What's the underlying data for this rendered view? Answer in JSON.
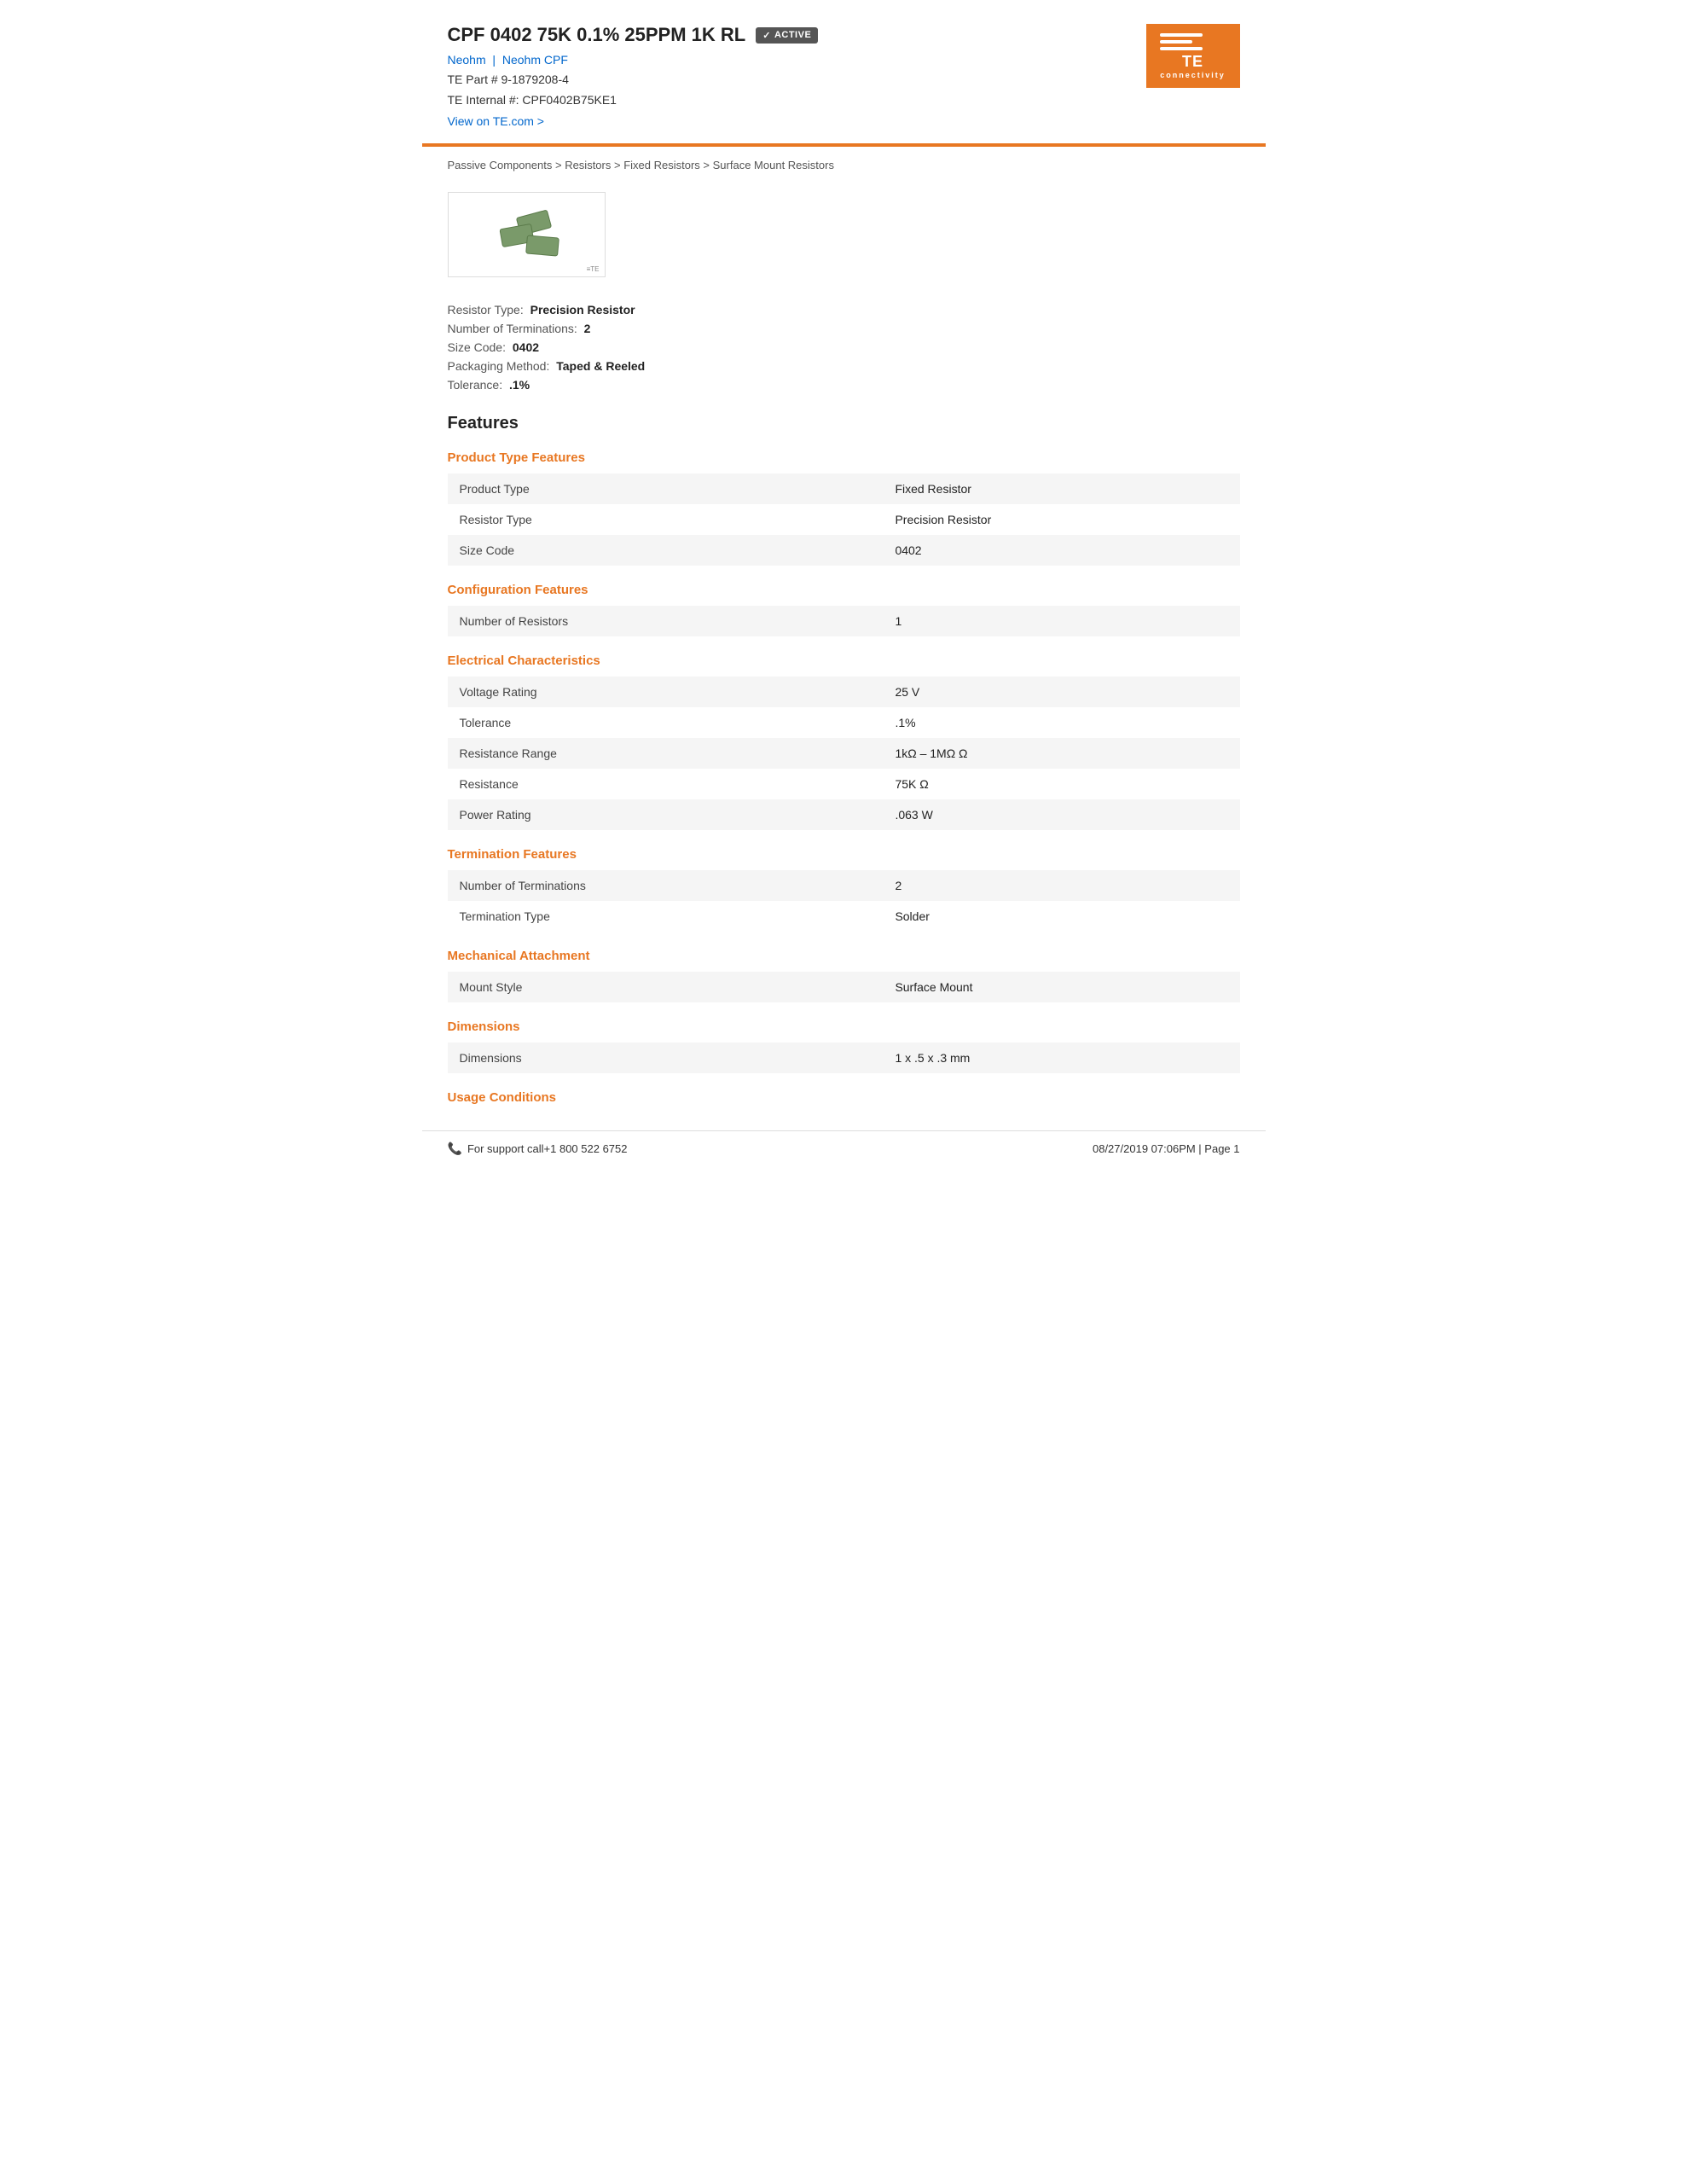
{
  "header": {
    "title": "CPF 0402 75K 0.1% 25PPM 1K RL",
    "active_badge": "ACTIVE",
    "brand_link1": "Neohm",
    "brand_link2": "Neohm CPF",
    "part_number": "TE Part # 9-1879208-4",
    "internal_number": "TE Internal #: CPF0402B75KE1",
    "view_link": "View on TE.com >"
  },
  "breadcrumb": {
    "items": [
      "Passive Components",
      "Resistors",
      "Fixed Resistors",
      "Surface Mount Resistors"
    ],
    "separator": ">"
  },
  "quick_specs": {
    "resistor_type_label": "Resistor Type:",
    "resistor_type_value": "Precision Resistor",
    "terminations_label": "Number of Terminations:",
    "terminations_value": "2",
    "size_code_label": "Size Code:",
    "size_code_value": "0402",
    "packaging_label": "Packaging Method:",
    "packaging_value": "Taped & Reeled",
    "tolerance_label": "Tolerance:",
    "tolerance_value": ".1%"
  },
  "features": {
    "section_title": "Features",
    "subsections": [
      {
        "title": "Product Type Features",
        "rows": [
          {
            "label": "Product Type",
            "value": "Fixed Resistor"
          },
          {
            "label": "Resistor Type",
            "value": "Precision Resistor"
          },
          {
            "label": "Size Code",
            "value": "0402"
          }
        ]
      },
      {
        "title": "Configuration Features",
        "rows": [
          {
            "label": "Number of Resistors",
            "value": "1"
          }
        ]
      },
      {
        "title": "Electrical Characteristics",
        "rows": [
          {
            "label": "Voltage Rating",
            "value": "25 V"
          },
          {
            "label": "Tolerance",
            "value": ".1%"
          },
          {
            "label": "Resistance Range",
            "value": "1kΩ – 1MΩ Ω"
          },
          {
            "label": "Resistance",
            "value": "75K Ω"
          },
          {
            "label": "Power Rating",
            "value": ".063 W"
          }
        ]
      },
      {
        "title": "Termination Features",
        "rows": [
          {
            "label": "Number of Terminations",
            "value": "2"
          },
          {
            "label": "Termination Type",
            "value": "Solder"
          }
        ]
      },
      {
        "title": "Mechanical Attachment",
        "rows": [
          {
            "label": "Mount Style",
            "value": "Surface Mount"
          }
        ]
      },
      {
        "title": "Dimensions",
        "rows": [
          {
            "label": "Dimensions",
            "value": "1 x .5 x .3 mm"
          }
        ]
      },
      {
        "title": "Usage Conditions",
        "rows": []
      }
    ]
  },
  "footer": {
    "support_text": "For support call+1 800 522 6752",
    "date_page": "08/27/2019 07:06PM | Page 1"
  },
  "logo": {
    "brand": "TE",
    "tagline": "connectivity"
  }
}
